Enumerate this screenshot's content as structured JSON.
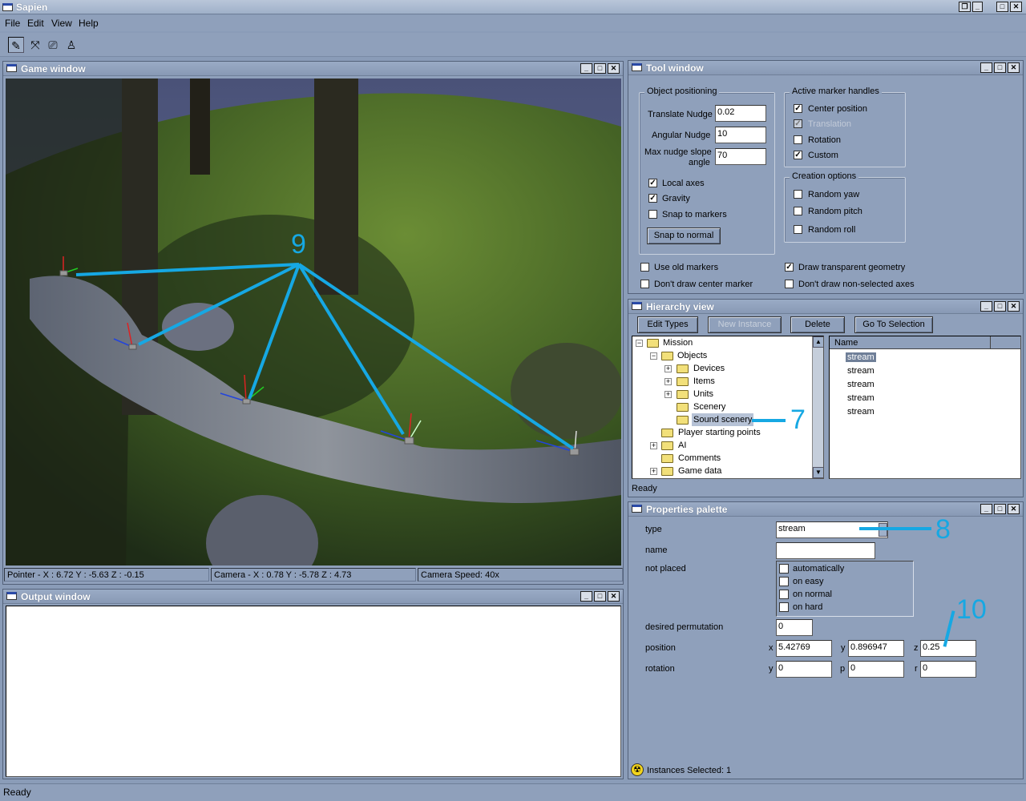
{
  "app": {
    "title": "Sapien",
    "status": "Ready"
  },
  "menu": [
    "File",
    "Edit",
    "View",
    "Help"
  ],
  "toolbar": {
    "tools": [
      "pencil-icon",
      "cross-icon",
      "camera-icon",
      "figure-icon"
    ]
  },
  "game_window": {
    "title": "Game window",
    "status": {
      "pointer": "Pointer - X : 6.72  Y : -5.63  Z : -0.15",
      "camera": "Camera - X : 0.78  Y : -5.78  Z : 4.73",
      "camera_speed": "Camera Speed: 40x"
    }
  },
  "output_window": {
    "title": "Output window"
  },
  "tool_window": {
    "title": "Tool window",
    "object_positioning": {
      "legend": "Object positioning",
      "translate_nudge_label": "Translate Nudge",
      "translate_nudge": "0.02",
      "angular_nudge_label": "Angular Nudge",
      "angular_nudge": "10",
      "max_nudge_label_1": "Max nudge slope",
      "max_nudge_label_2": "angle",
      "max_nudge": "70",
      "local_axes": "Local axes",
      "gravity": "Gravity",
      "snap_to_markers": "Snap to markers",
      "snap_to_normal": "Snap to normal"
    },
    "active_marker_handles": {
      "legend": "Active marker handles",
      "center_position": "Center position",
      "translation": "Translation",
      "rotation": "Rotation",
      "custom": "Custom"
    },
    "creation_options": {
      "legend": "Creation options",
      "random_yaw": "Random yaw",
      "random_pitch": "Random pitch",
      "random_roll": "Random roll"
    },
    "use_old_markers": "Use old markers",
    "dont_draw_center": "Don't draw center marker",
    "draw_transparent": "Draw transparent geometry",
    "dont_draw_axes": "Don't draw non-selected axes"
  },
  "hierarchy": {
    "title": "Hierarchy view",
    "buttons": {
      "edit_types": "Edit Types",
      "new_instance": "New Instance",
      "delete": "Delete",
      "go_to_selection": "Go To Selection"
    },
    "tree": {
      "mission": "Mission",
      "objects": "Objects",
      "devices": "Devices",
      "items": "Items",
      "units": "Units",
      "scenery": "Scenery",
      "sound_scenery": "Sound scenery",
      "player_start": "Player starting points",
      "ai": "AI",
      "comments": "Comments",
      "game_data": "Game data"
    },
    "list_header": "Name",
    "list": [
      "stream",
      "stream",
      "stream",
      "stream",
      "stream"
    ],
    "status": "Ready"
  },
  "properties": {
    "title": "Properties palette",
    "type_label": "type",
    "type_value": "stream",
    "name_label": "name",
    "name_value": "",
    "not_placed_label": "not placed",
    "not_placed_options": [
      "automatically",
      "on easy",
      "on normal",
      "on hard"
    ],
    "perm_label": "desired permutation",
    "perm_value": "0",
    "position_label": "position",
    "pos": {
      "x_label": "x",
      "x": "5.42769",
      "y_label": "y",
      "y": "0.896947",
      "z_label": "z",
      "z": "0.25"
    },
    "rotation_label": "rotation",
    "rot": {
      "y_label": "y",
      "y": "0",
      "p_label": "p",
      "p": "0",
      "r_label": "r",
      "r": "0"
    },
    "instances_selected": "Instances Selected: 1"
  },
  "annotations": {
    "nine": "9",
    "seven": "7",
    "eight": "8",
    "ten": "10"
  },
  "colors": {
    "annotation": "#16a8e3",
    "panel": "#8fa0bb",
    "title_text": "#ffffff"
  }
}
